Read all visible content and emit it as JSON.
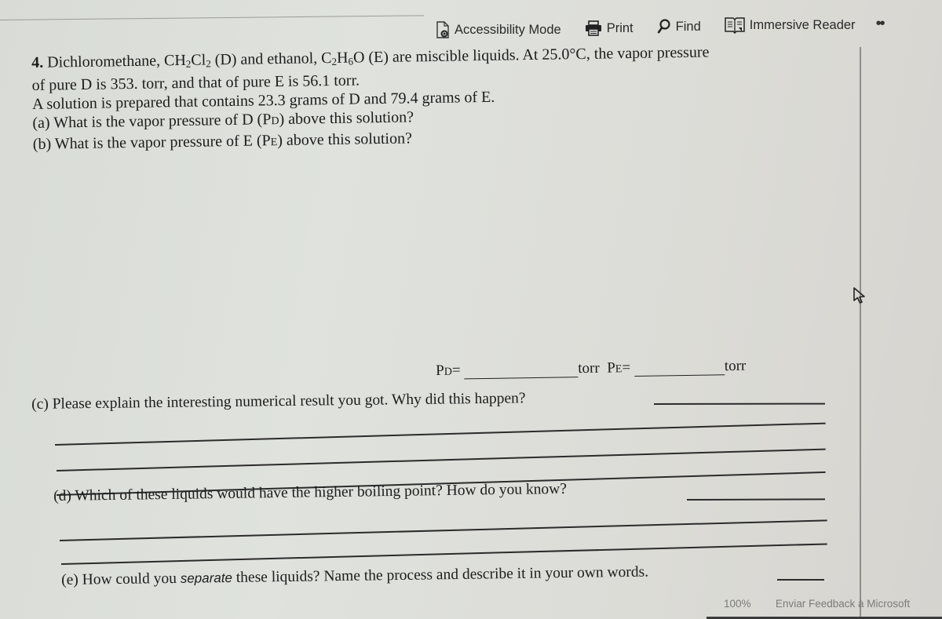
{
  "toolbar": {
    "accessibility_label": "Accessibility Mode",
    "print_label": "Print",
    "find_label": "Find",
    "immersive_label": "Immersive Reader",
    "more_label": "••"
  },
  "question": {
    "number": "4.",
    "line1_a": "Dichloromethane, CH",
    "line1_b": "Cl",
    "line1_c": " (D) and ethanol, C",
    "line1_d": "H",
    "line1_e": "O (E) are miscible liquids.  At 25.0°C, the vapor pressure",
    "sub_2": "2",
    "sub_6": "6",
    "line2": "of pure D is 353. torr, and that of pure E is 56.1 torr.",
    "line3": "A solution is prepared that contains 23.3 grams of D and 79.4 grams of E.",
    "part_a_1": "(a) What is the vapor pressure  of D (P",
    "part_a_sub": "D",
    "part_a_2": ") above this solution?",
    "part_b_1": "(b) What is the vapor pressure  of E (P",
    "part_b_sub": "E",
    "part_b_2": ") above this solution?"
  },
  "answers": {
    "pd_label": "P",
    "pd_sub": "D",
    "eq": "=",
    "unit": "torr",
    "pe_label": "P",
    "pe_sub": "E",
    "pd_value": "",
    "pe_value": ""
  },
  "part_c": {
    "text": "(c) Please explain the interesting numerical result you got.  Why did this happen?"
  },
  "part_d": {
    "text": "(d) Which of these liquids would have the higher boiling point?  How do you know?"
  },
  "part_e": {
    "text_a": "(e) How could you ",
    "text_em": "separate",
    "text_b": " these liquids? Name the process and describe it in your own words."
  },
  "status": {
    "zoom": "100%",
    "feedback": "Enviar Feedback à Microsoft"
  }
}
